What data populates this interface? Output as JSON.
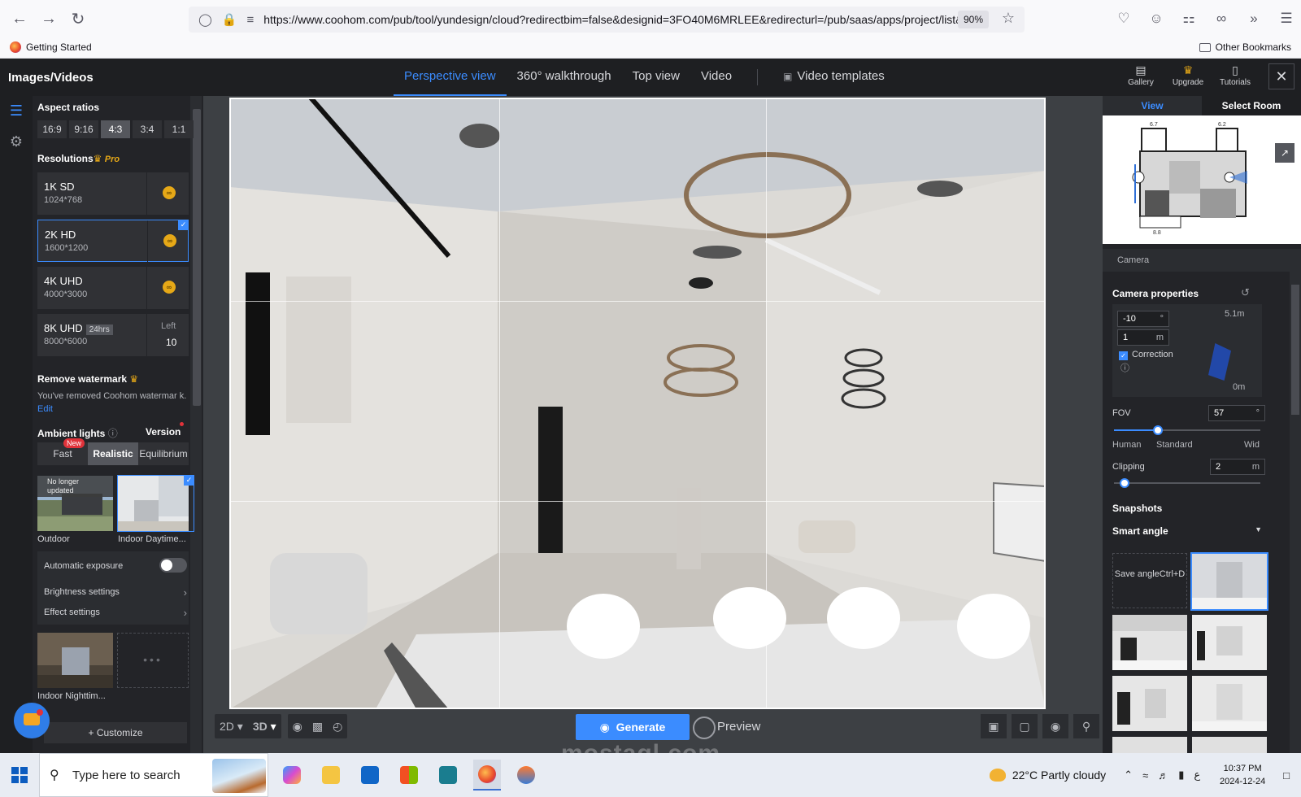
{
  "browser": {
    "url": "https://www.coohom.com/pub/tool/yundesign/cloud?redirectbim=false&designid=3FO40M6MRLEE&redirecturl=/pub/saas/apps/project/list&",
    "zoom": "90%",
    "bookmark_left": "Getting Started",
    "bookmark_right": "Other Bookmarks"
  },
  "app": {
    "title": "Images/Videos",
    "tabs": [
      "Perspective view",
      "360° walkthrough",
      "Top view",
      "Video",
      "Video templates"
    ],
    "actions": [
      "Gallery",
      "Upgrade",
      "Tutorials"
    ]
  },
  "left": {
    "aspect_title": "Aspect ratios",
    "ratios": [
      "16:9",
      "9:16",
      "4:3",
      "3:4",
      "1:1"
    ],
    "selected_ratio": "4:3",
    "resolutions_title": "Resolutions",
    "pro_label": "Pro",
    "resolutions": [
      {
        "name": "1K SD",
        "size": "1024*768"
      },
      {
        "name": "2K HD",
        "size": "1600*1200"
      },
      {
        "name": "4K UHD",
        "size": "4000*3000"
      },
      {
        "name": "8K UHD",
        "size": "8000*6000",
        "badge": "24hrs",
        "left_label": "Left",
        "left_value": "10"
      }
    ],
    "watermark_title": "Remove watermark",
    "watermark_text": "You've removed Coohom watermar k.",
    "watermark_edit": "Edit",
    "ambient_title": "Ambient lights",
    "version_label": "Version",
    "modes": [
      "Fast",
      "Realistic",
      "Equilibrium"
    ],
    "new_tag": "New",
    "presets": [
      {
        "label": "Outdoor",
        "tag": "No longer updated"
      },
      {
        "label": "Indoor Daytime..."
      },
      {
        "label": "Indoor Nighttim..."
      }
    ],
    "auto_exposure": "Automatic exposure",
    "brightness": "Brightness settings",
    "effect": "Effect settings",
    "customize": "Customize"
  },
  "viewport": {
    "mode_2d": "2D",
    "mode_3d": "3D",
    "generate": "Generate",
    "preview": "Preview",
    "watermark_text": "mostaql.com"
  },
  "right": {
    "tab_view": "View",
    "tab_room": "Select Room",
    "camera_header": "Camera",
    "camera_props": "Camera properties",
    "pitch": "-10",
    "pitch_unit": "°",
    "height": "1",
    "height_unit": "m",
    "top_label": "5.1m",
    "bottom_label": "0m",
    "correction": "Correction",
    "fov_label": "FOV",
    "fov_value": "57",
    "fov_unit": "°",
    "fov_level": 0.3,
    "fov_scale": [
      "Human",
      "Standard",
      "Wid"
    ],
    "clipping_label": "Clipping",
    "clipping_value": "2",
    "clipping_unit": "m",
    "clipping_level": 0.07,
    "snapshots_title": "Snapshots",
    "snapshot_mode": "Smart angle",
    "save_angle": "Save angleCtrl+D",
    "plan_dims": [
      "6.7",
      "6.2",
      "8.8"
    ]
  },
  "taskbar": {
    "search_placeholder": "Type here to search",
    "weather": "22°C  Partly cloudy",
    "lang": "ع",
    "time": "10:37 PM",
    "date": "2024-12-24"
  }
}
